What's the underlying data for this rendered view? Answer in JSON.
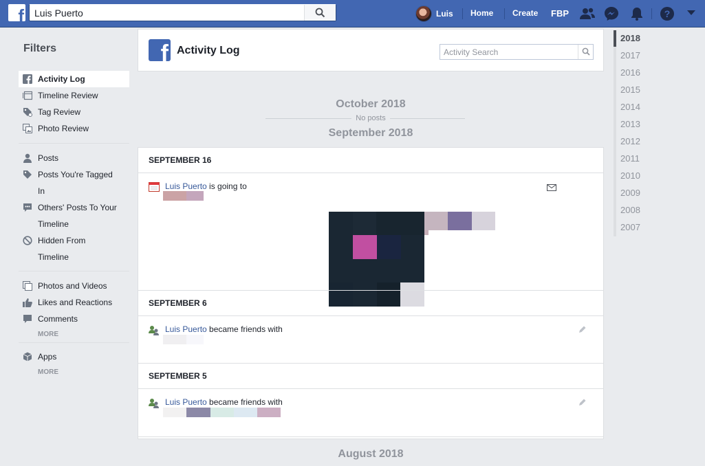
{
  "topbar": {
    "search_value": "Luis Puerto",
    "user_name": "Luis",
    "nav": [
      "Home",
      "Create",
      "FBP"
    ]
  },
  "filters": {
    "title": "Filters",
    "group1": [
      "Activity Log",
      "Timeline Review",
      "Tag Review",
      "Photo Review"
    ],
    "posts": "Posts",
    "tagged_1": "Posts You're Tagged",
    "tagged_2": "In",
    "others_1": "Others' Posts To Your",
    "others_2": "Timeline",
    "hidden_1": "Hidden From",
    "hidden_2": "Timeline",
    "group3": [
      "Photos and Videos",
      "Likes and Reactions",
      "Comments"
    ],
    "more": "MORE",
    "apps": "Apps"
  },
  "header": {
    "title": "Activity Log",
    "search_placeholder": "Activity Search"
  },
  "timeline": {
    "october": "October 2018",
    "no_posts": "No posts",
    "september": "September 2018",
    "august": "August 2018",
    "days": [
      {
        "label": "SEPTEMBER 16",
        "name": "Luis Puerto",
        "text": " is going to"
      },
      {
        "label": "SEPTEMBER 6",
        "name": "Luis Puerto",
        "text": " became friends with"
      },
      {
        "label": "SEPTEMBER 5",
        "name": "Luis Puerto",
        "text": " became friends with"
      }
    ]
  },
  "years": [
    "2018",
    "2017",
    "2016",
    "2015",
    "2014",
    "2013",
    "2012",
    "2011",
    "2010",
    "2009",
    "2008",
    "2007"
  ],
  "colors": {
    "brand": "#4267b2",
    "link": "#365899",
    "background": "#e9ebee"
  }
}
